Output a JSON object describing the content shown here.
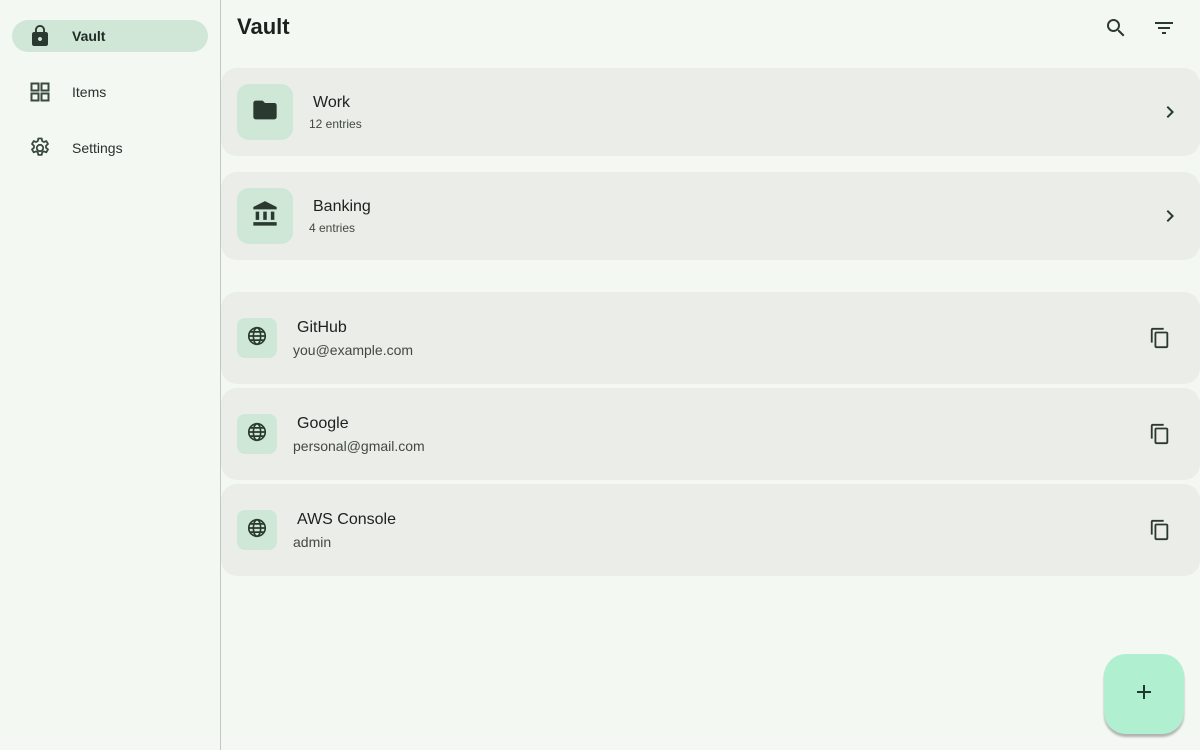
{
  "colors": {
    "background": "#f4f8f3",
    "card": "#eaede8",
    "icon_container": "#cfe7d7",
    "nav_active": "#d0e7d8",
    "fab": "#b0f0d0",
    "icon": "#2a3a30"
  },
  "sidebar": {
    "items": [
      {
        "label": "Vault",
        "icon": "lock-icon",
        "active": true
      },
      {
        "label": "Items",
        "icon": "grid-icon",
        "active": false
      },
      {
        "label": "Settings",
        "icon": "gear-icon",
        "active": false
      }
    ]
  },
  "header": {
    "title": "Vault",
    "actions": [
      {
        "icon": "search-icon"
      },
      {
        "icon": "filter-icon"
      }
    ]
  },
  "folders": [
    {
      "title": "Work",
      "subtitle": "12 entries",
      "icon": "folder-icon"
    },
    {
      "title": "Banking",
      "subtitle": "4 entries",
      "icon": "bank-icon"
    }
  ],
  "entries": [
    {
      "title": "GitHub",
      "subtitle": "you@example.com",
      "icon": "globe-icon",
      "action_icon": "copy-icon"
    },
    {
      "title": "Google",
      "subtitle": "personal@gmail.com",
      "icon": "globe-icon",
      "action_icon": "copy-icon"
    },
    {
      "title": "AWS Console",
      "subtitle": "admin",
      "icon": "globe-icon",
      "action_icon": "copy-icon"
    }
  ],
  "fab": {
    "icon": "plus-icon"
  }
}
